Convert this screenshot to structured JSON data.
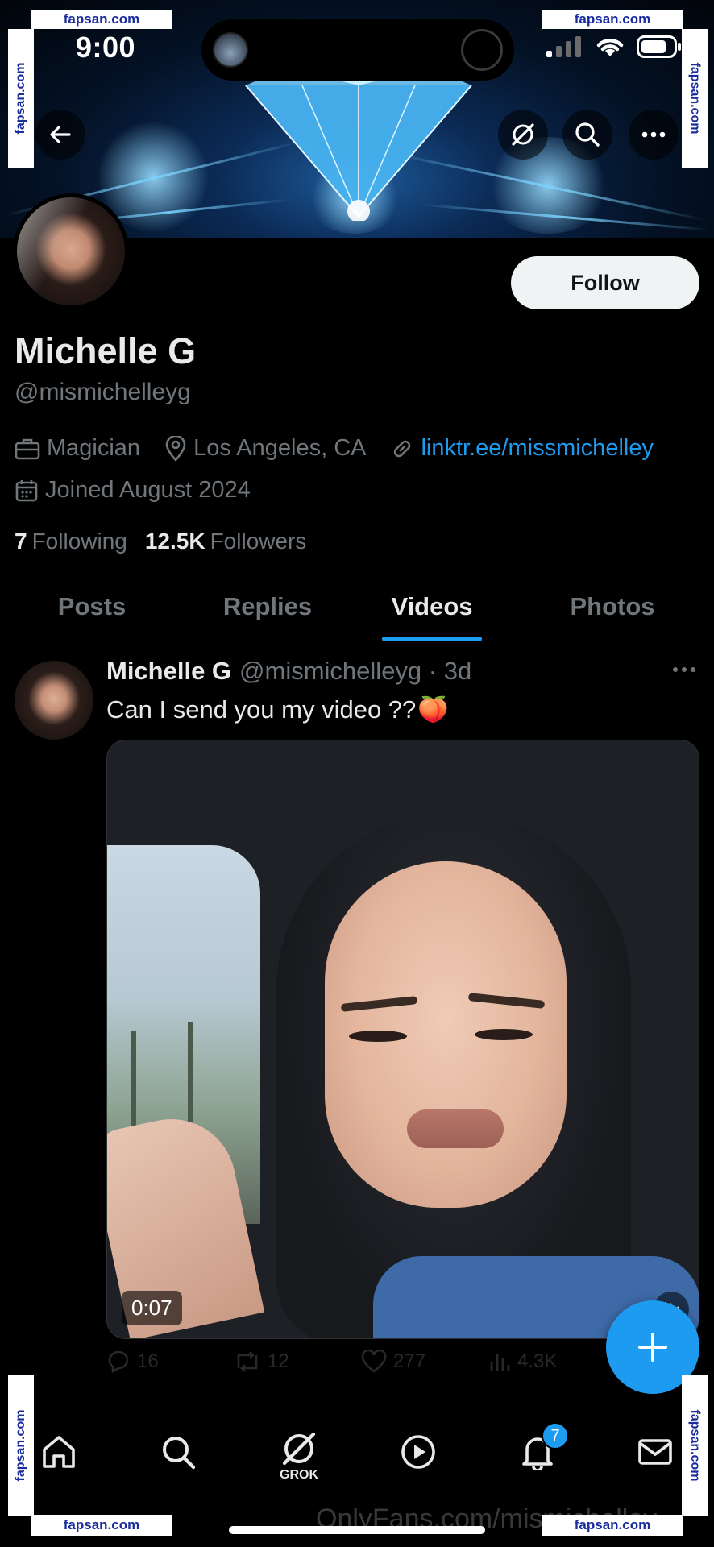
{
  "status_bar": {
    "time": "9:00"
  },
  "watermark": {
    "site": "fapsan.com",
    "footer_text": "OnlyFans.com/mismichelley"
  },
  "profile": {
    "display_name": "Michelle G",
    "handle": "@mismichelleyg",
    "follow_label": "Follow",
    "occupation": "Magician",
    "location": "Los Angeles, CA",
    "link": "linktr.ee/missmichelley",
    "joined": "Joined August 2024",
    "following_count": "7",
    "following_label": "Following",
    "followers_count": "12.5K",
    "followers_label": "Followers"
  },
  "tabs": [
    {
      "label": "Posts",
      "active": false
    },
    {
      "label": "Replies",
      "active": false
    },
    {
      "label": "Videos",
      "active": true
    },
    {
      "label": "Photos",
      "active": false
    }
  ],
  "post": {
    "author_name": "Michelle G",
    "author_handle": "@mismichelleyg · 3d",
    "text": "Can I send you my video ??",
    "emoji": "🍑",
    "video_duration": "0:07",
    "replies": "16",
    "reposts": "12",
    "likes": "277",
    "views": "4.3K"
  },
  "bottom_nav": {
    "grok_label": "GROK",
    "notification_badge": "7"
  },
  "colors": {
    "accent": "#1d9bf0",
    "background": "#000000",
    "text_primary": "#e7e9ea",
    "text_secondary": "#71767b",
    "watermark_text": "#1a2c9e"
  }
}
